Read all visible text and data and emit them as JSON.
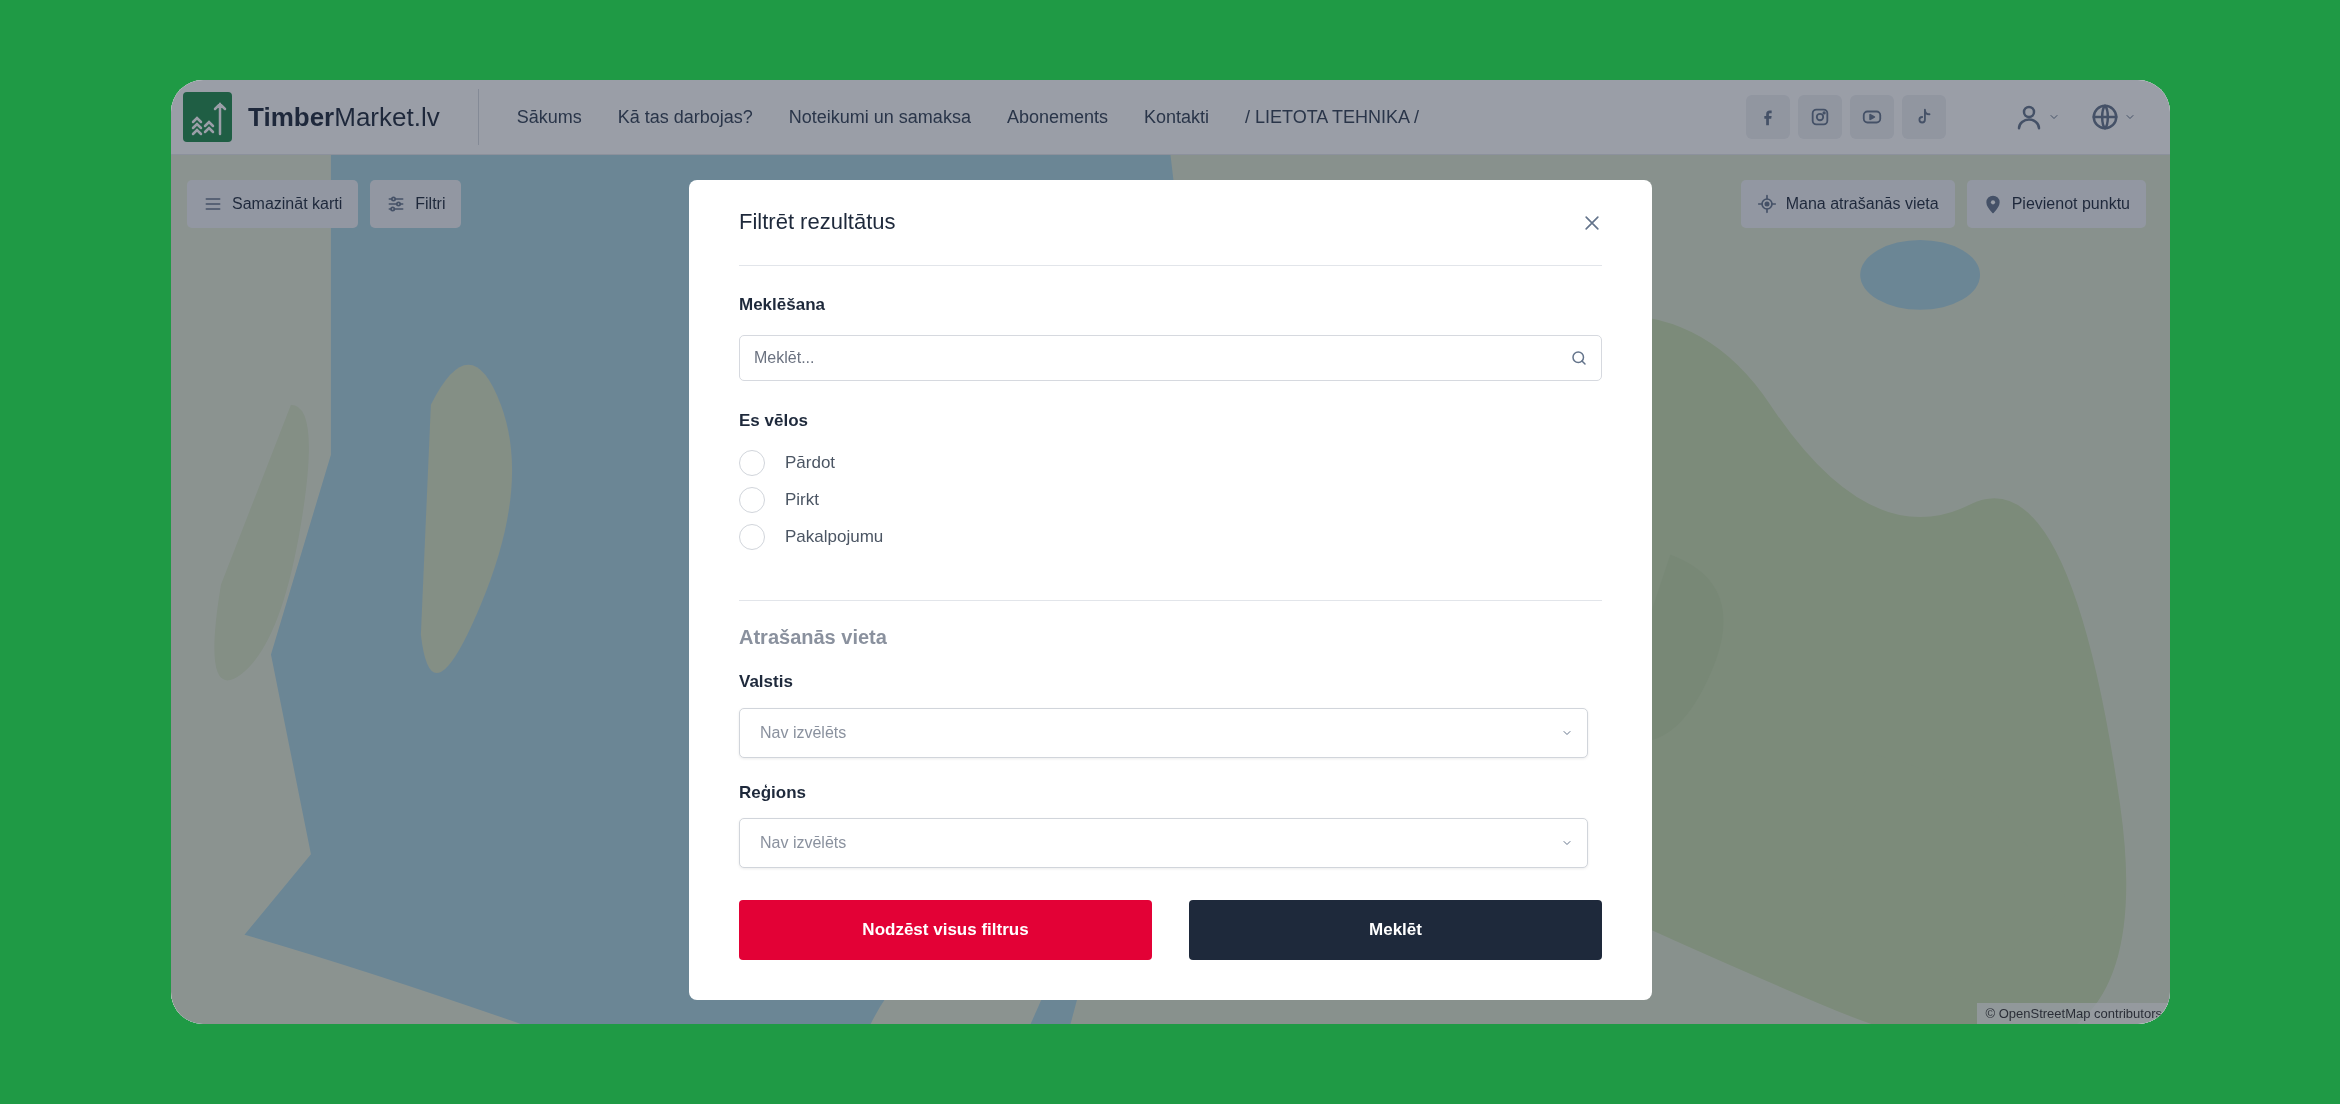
{
  "navbar": {
    "logo": "**Timber**Market.lv",
    "links": [
      "Sākums",
      "Kā tas darbojas?",
      "Noteikumi un samaksa",
      "Abonements",
      "Kontakti",
      "/ LIETOTA TEHNIKA /"
    ]
  },
  "map": {
    "controls_left": [
      {
        "label": "Samazināt karti"
      },
      {
        "label": "Filtri"
      }
    ],
    "controls_right": [
      {
        "label": "Mana atrašanās vieta"
      },
      {
        "label": "Pievienot punktu"
      }
    ],
    "attribution": {
      "prefix": "©",
      "link": "OpenStreetMap contributors"
    }
  },
  "modal": {
    "title": "Filtrēt rezultātus",
    "search": {
      "label": "Meklēšana",
      "placeholder": "Meklēt..."
    },
    "intent": {
      "label": "Es vēlos",
      "options": [
        {
          "label": "Pārdot",
          "selected": false
        },
        {
          "label": "Pirkt",
          "selected": false
        },
        {
          "label": "Pakalpojumu",
          "selected": false
        }
      ]
    },
    "location": {
      "heading": "Atrašanās vieta",
      "fields": [
        {
          "label": "Valstis",
          "placeholder": "Nav izvēlēts"
        },
        {
          "label": "Reģions",
          "placeholder": "Nav izvēlēts"
        }
      ]
    },
    "buttons": [
      {
        "label": "Nodzēst visus filtrus",
        "kind": "danger"
      },
      {
        "label": "Meklēt",
        "kind": "primary"
      }
    ]
  }
}
